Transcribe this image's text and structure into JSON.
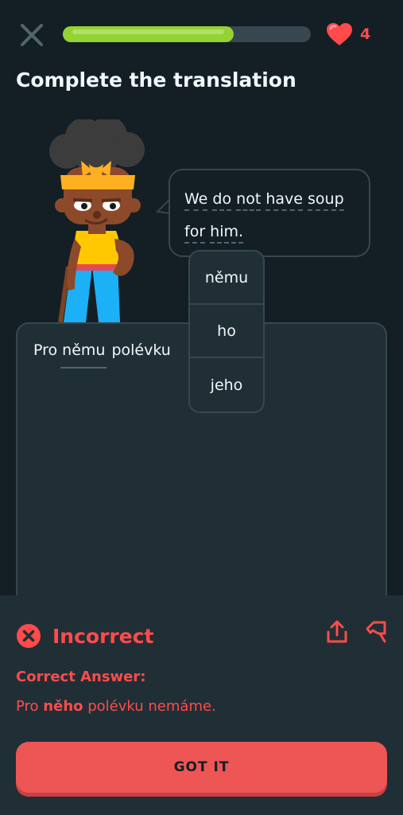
{
  "header": {
    "progress": 0.69,
    "hearts_count": "4",
    "colors": {
      "progress": "#93d333",
      "heart": "#ff4b4b"
    }
  },
  "prompt": {
    "title": "Complete the translation"
  },
  "speech": {
    "line1": [
      "We",
      "do",
      "not",
      "have",
      "soup"
    ],
    "line2": [
      "for",
      "him."
    ]
  },
  "sentence": {
    "start": "Pro",
    "blank": "němu",
    "rest": "polévku"
  },
  "hints": {
    "options": [
      "němu",
      "ho",
      "jeho"
    ]
  },
  "feedback": {
    "status": "Incorrect",
    "correct_label": "Correct Answer:",
    "correct_before": "Pro",
    "correct_highlight": "něho",
    "correct_after": "polévku nemáme.",
    "button": "GOT IT",
    "colors": {
      "error": "#ff4b4b",
      "button": "#ee5555"
    }
  }
}
